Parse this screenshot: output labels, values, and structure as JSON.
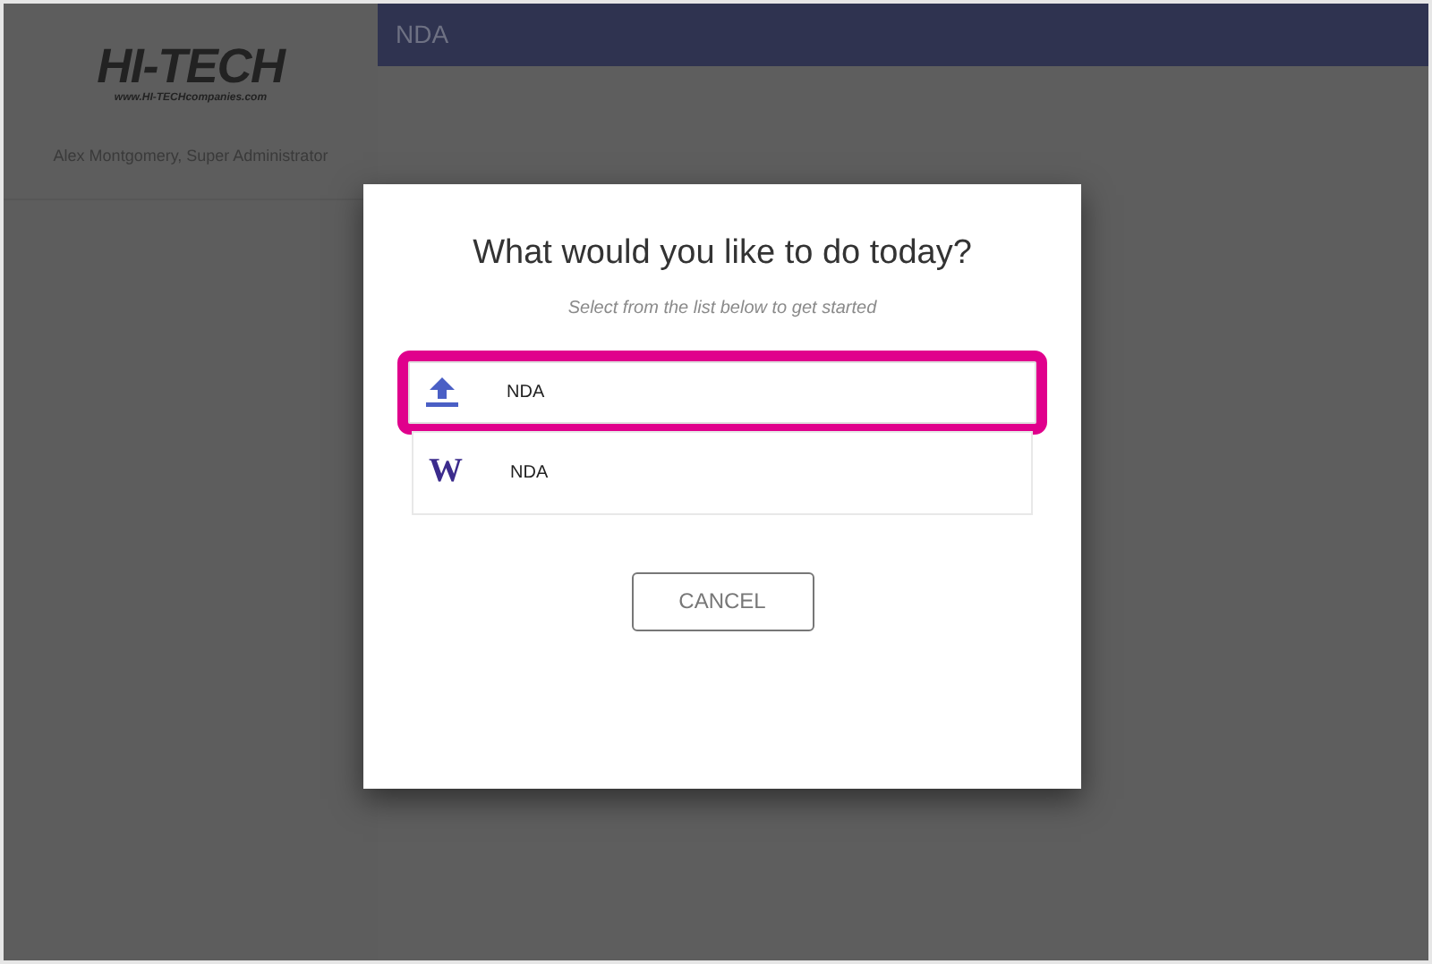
{
  "sidebar": {
    "logo": "HI-TECH",
    "logo_url": "www.HI-TECHcompanies.com",
    "user": "Alex Montgomery, Super Administrator"
  },
  "top_bar": {
    "title": "NDA"
  },
  "dialog": {
    "title": "What would you like to do today?",
    "subtitle": "Select from the list below to get started",
    "options": [
      {
        "kind": "upload",
        "label": "NDA",
        "highlighted": true
      },
      {
        "kind": "letter",
        "glyph": "W",
        "label": "NDA",
        "highlighted": false
      }
    ],
    "cancel": "CANCEL"
  }
}
